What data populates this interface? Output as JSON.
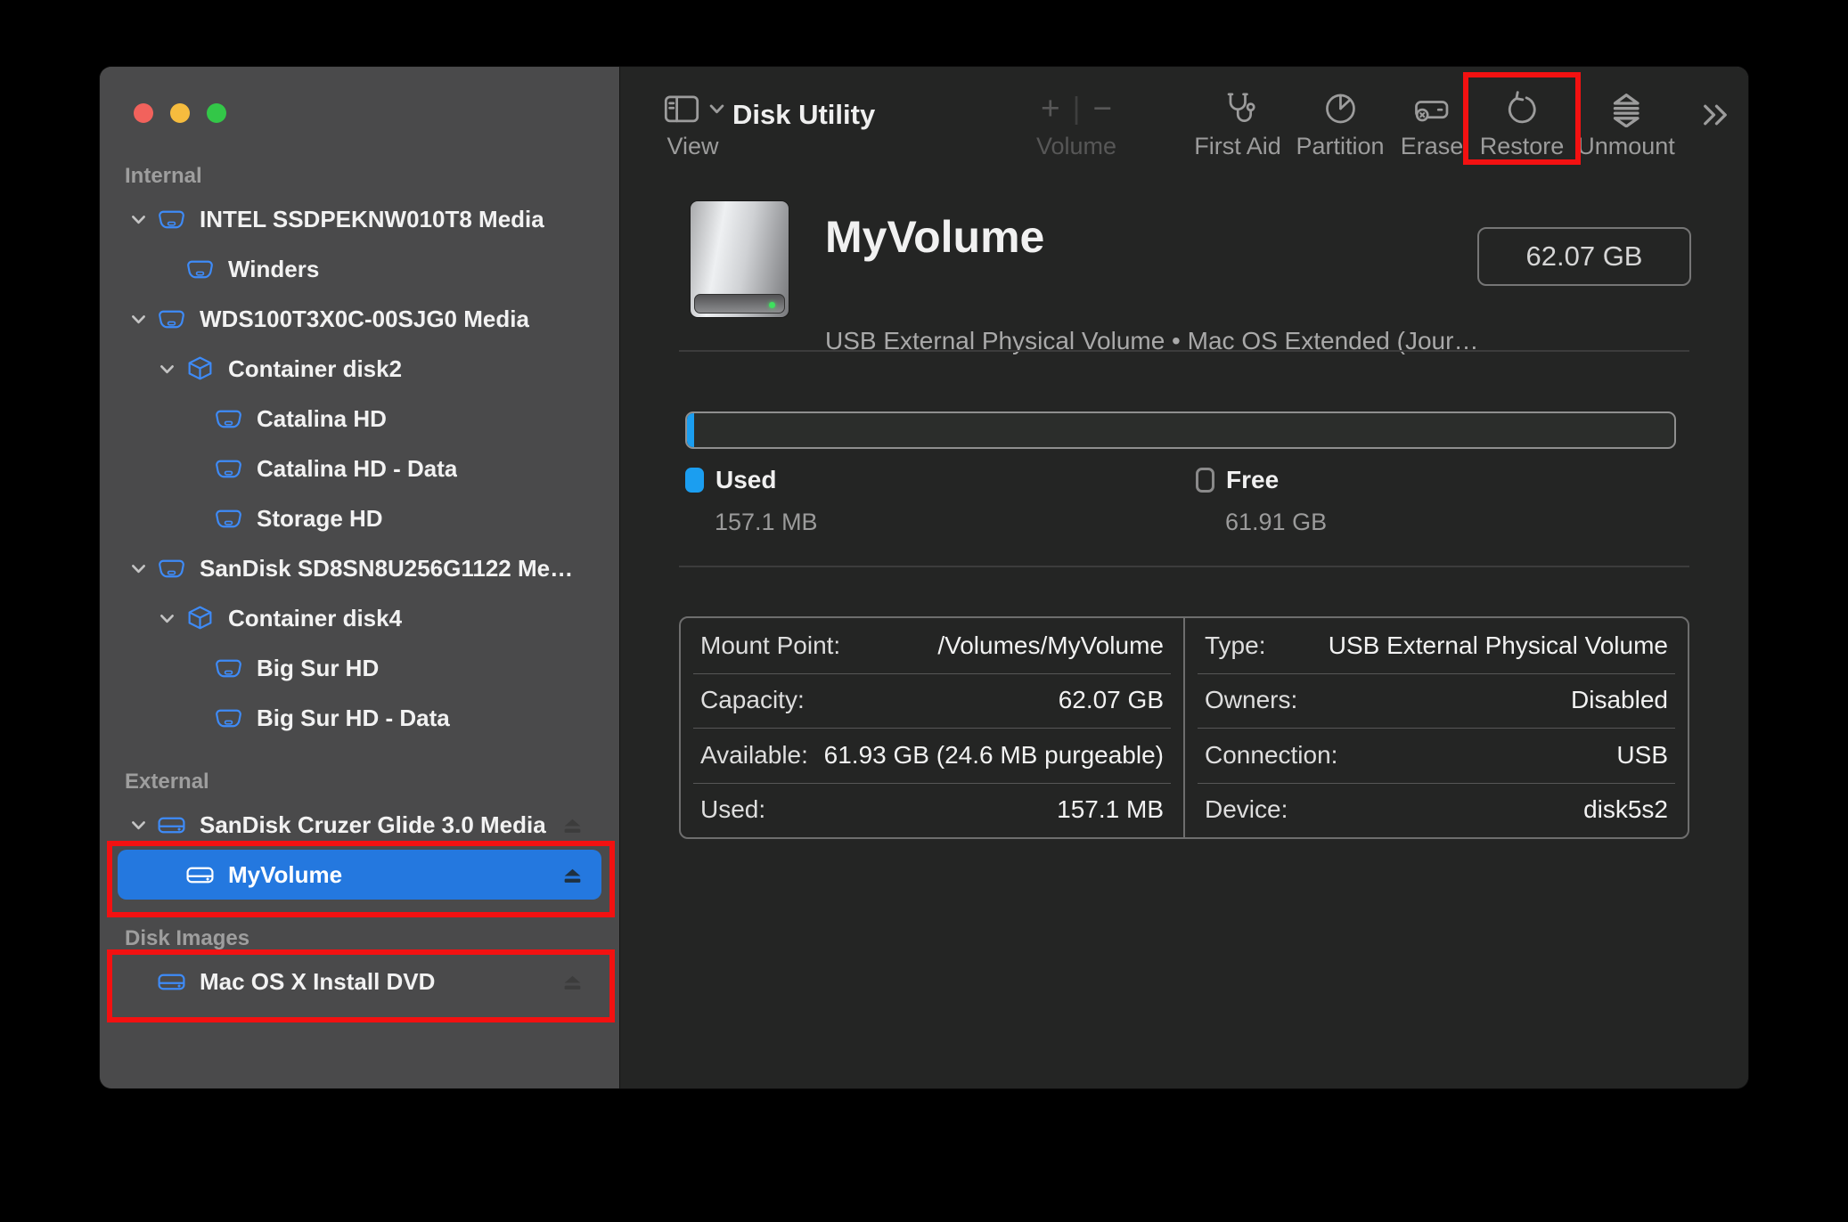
{
  "window_controls": [
    "close",
    "minimize",
    "zoom"
  ],
  "colors": {
    "traffic_red": "#F2625C",
    "traffic_yellow": "#F6BC3E",
    "traffic_green": "#33C748",
    "accent_blue": "#3E8BF8",
    "selection_blue": "#2478DF",
    "highlight_red": "#F31111",
    "used_blue": "#1B9EF0"
  },
  "toolbar": {
    "view_label": "View",
    "title": "Disk Utility",
    "volume_group": {
      "label": "Volume",
      "plus": "+",
      "minus": "−",
      "disabled": true
    },
    "buttons": [
      {
        "label": "First Aid",
        "icon": "stethoscope-icon"
      },
      {
        "label": "Partition",
        "icon": "pie-chart-icon"
      },
      {
        "label": "Erase",
        "icon": "erase-disk-icon"
      },
      {
        "label": "Restore",
        "icon": "restore-arrow-icon",
        "highlighted": true
      },
      {
        "label": "Unmount",
        "icon": "unmount-eject-icon"
      }
    ],
    "overflow_icon": "double-chevron-right-icon"
  },
  "sidebar": {
    "sections": [
      {
        "label": "Internal",
        "items": [
          {
            "label": "INTEL SSDPEKNW010T8 Media",
            "icon": "disk-icon",
            "level": 1,
            "chevron": true
          },
          {
            "label": "Winders",
            "icon": "disk-icon",
            "level": 2
          },
          {
            "label": "WDS100T3X0C-00SJG0 Media",
            "icon": "disk-icon",
            "level": 1,
            "chevron": true
          },
          {
            "label": "Container disk2",
            "icon": "container-icon",
            "level": 2,
            "chevron": true
          },
          {
            "label": "Catalina HD",
            "icon": "disk-icon",
            "level": 3
          },
          {
            "label": "Catalina HD - Data",
            "icon": "disk-icon",
            "level": 3
          },
          {
            "label": "Storage HD",
            "icon": "disk-icon",
            "level": 3
          },
          {
            "label": "SanDisk SD8SN8U256G1122 Me…",
            "icon": "disk-icon",
            "level": 1,
            "chevron": true
          },
          {
            "label": "Container disk4",
            "icon": "container-icon",
            "level": 2,
            "chevron": true
          },
          {
            "label": "Big Sur HD",
            "icon": "disk-icon",
            "level": 3
          },
          {
            "label": "Big Sur HD - Data",
            "icon": "disk-icon",
            "level": 3
          }
        ]
      },
      {
        "label": "External",
        "items": [
          {
            "label": "SanDisk Cruzer Glide 3.0 Media",
            "icon": "external-disk-icon",
            "level": 1,
            "chevron": true,
            "eject": true,
            "eject_dim": true
          },
          {
            "label": "MyVolume",
            "icon": "external-disk-icon",
            "level": 2,
            "eject": true,
            "selected": true
          }
        ]
      },
      {
        "label": "Disk Images",
        "items": [
          {
            "label": "Mac OS X Install DVD",
            "icon": "external-disk-icon",
            "level": 1,
            "eject": true,
            "eject_dim": true
          }
        ]
      }
    ]
  },
  "header": {
    "name": "MyVolume",
    "subtitle": "USB External Physical Volume • Mac OS Extended (Jour…",
    "size_badge": "62.07 GB"
  },
  "usage": {
    "used_label": "Used",
    "used_value": "157.1 MB",
    "free_label": "Free",
    "free_value": "61.91 GB",
    "used_fraction": 0.0025
  },
  "details": {
    "left": [
      {
        "label": "Mount Point:",
        "value": "/Volumes/MyVolume"
      },
      {
        "label": "Capacity:",
        "value": "62.07 GB"
      },
      {
        "label": "Available:",
        "value": "61.93 GB (24.6 MB purgeable)"
      },
      {
        "label": "Used:",
        "value": "157.1 MB"
      }
    ],
    "right": [
      {
        "label": "Type:",
        "value": "USB External Physical Volume"
      },
      {
        "label": "Owners:",
        "value": "Disabled"
      },
      {
        "label": "Connection:",
        "value": "USB"
      },
      {
        "label": "Device:",
        "value": "disk5s2"
      }
    ]
  }
}
